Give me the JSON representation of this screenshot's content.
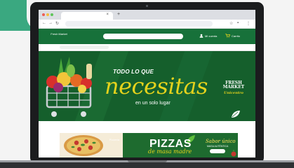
{
  "colors": {
    "brand_green": "#17713a",
    "hero_green": "#155f2c",
    "accent_yellow": "#e4d21c",
    "teal": "#3aa880"
  },
  "browser": {
    "tab_title": "",
    "icons": [
      "back-icon",
      "forward-icon",
      "reload-icon",
      "star-icon",
      "extensions-icon",
      "menu-icon"
    ]
  },
  "header": {
    "logo_text": "Fresh Market",
    "search_placeholder": "",
    "account_label": "Mi cuenta",
    "cart_label": "Carrito"
  },
  "hero": {
    "tagline": "TODO LO QUE",
    "headline": "necesitas",
    "subline": "en un solo lugar",
    "brand_line1": "FRESH",
    "brand_line2": "MARKET",
    "brand_sub": "Unicentro"
  },
  "promo": {
    "logo_text": "Pizzería",
    "title": "PIZZAS",
    "subtitle": "de masa madre",
    "right_title": "Sabor único",
    "right_small": "MASA AUTÉNTICA",
    "button_label": ""
  }
}
